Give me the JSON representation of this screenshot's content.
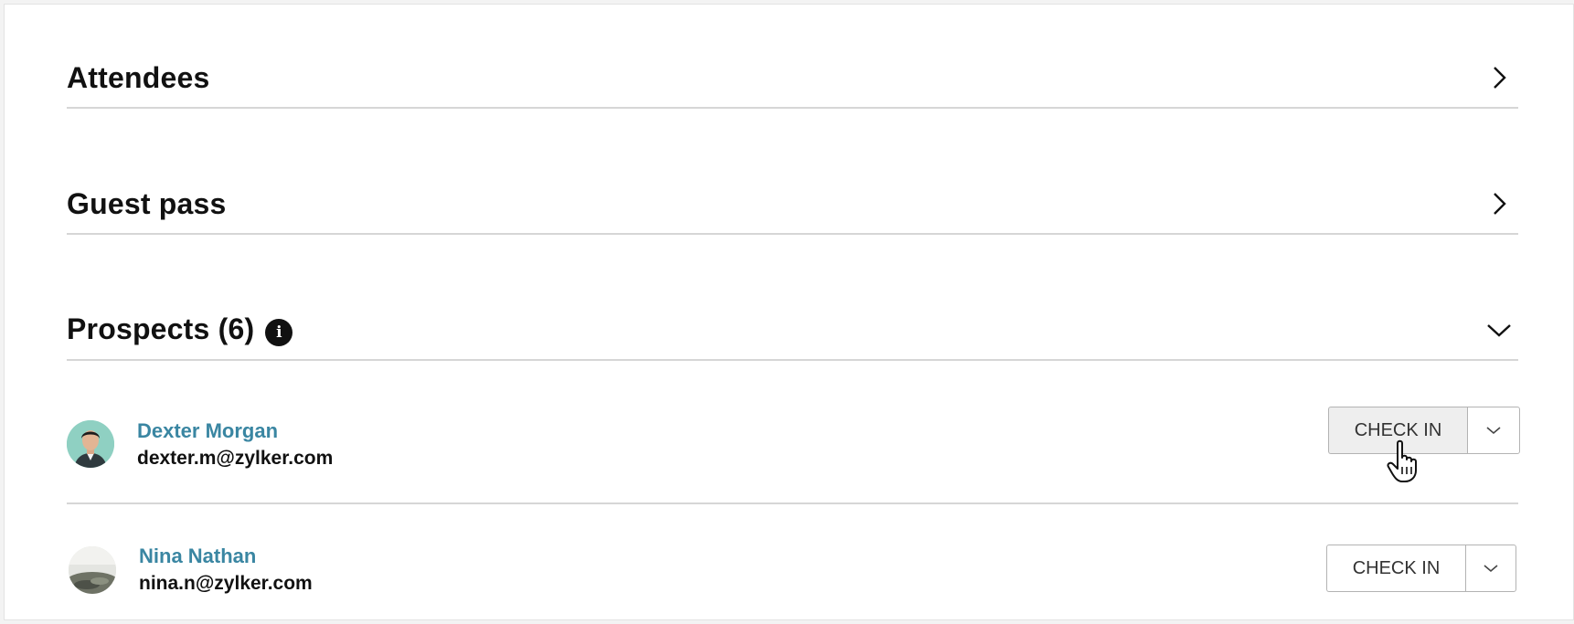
{
  "sections": [
    {
      "title": "Attendees",
      "state": "collapsed",
      "chevron": "chevron-right-icon"
    },
    {
      "title": "Guest pass",
      "state": "collapsed",
      "chevron": "chevron-right-icon"
    },
    {
      "title": "Prospects (6)",
      "state": "expanded",
      "chevron": "chevron-down-icon",
      "info_icon": "info-icon"
    }
  ],
  "prospects": [
    {
      "name": "Dexter Morgan",
      "email": "dexter.m@zylker.com",
      "action_label": "CHECK IN",
      "avatar": "avatar-photo",
      "state": "hover"
    },
    {
      "name": "Nina Nathan",
      "email": "nina.n@zylker.com",
      "action_label": "CHECK IN",
      "avatar": "avatar-photo",
      "state": "default"
    }
  ],
  "colors": {
    "link": "#3a86a2",
    "divider": "#d6d6d6",
    "button_border": "#b3b3b3",
    "button_hover_bg": "#eeeeee"
  }
}
